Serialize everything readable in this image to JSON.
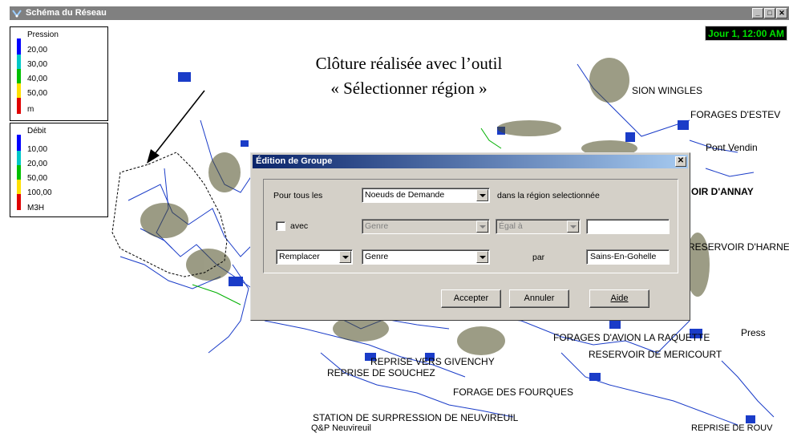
{
  "window": {
    "title": "Schéma du Réseau",
    "controls": [
      "_",
      "□",
      "✕"
    ],
    "day_time": "Jour 1, 12:00 AM"
  },
  "colors": {
    "legend_blue": "#0000ff",
    "legend_cyan": "#00c8c8",
    "legend_green": "#00c000",
    "legend_yellow": "#ffe000",
    "legend_red": "#e00000",
    "title_gradient_start": "#0a246a",
    "title_gradient_end": "#a6caf0"
  },
  "legend_pressure": {
    "title": "Pression",
    "items": [
      "20,00",
      "30,00",
      "40,00",
      "50,00"
    ],
    "unit": "m"
  },
  "legend_flow": {
    "title": "Débit",
    "items": [
      "10,00",
      "20,00",
      "50,00",
      "100,00"
    ],
    "unit": "M3H"
  },
  "annotation": {
    "line1": "Clôture réalisée avec l’outil",
    "line2": "« Sélectionner région »"
  },
  "map_labels": [
    "Q&P Neuvireuil",
    "STATION DE SURPRESSION DE NEUVIREUIL",
    "FORAGE DES FOURQUES",
    "REPRISE DE SOUCHEZ",
    "REPRISE VERS GIVENCHY",
    "RESERVOIR DE MERICOURT",
    "FORAGES D'AVION LA RAQUETTE",
    "RESERVOIR D'HARNES",
    "SION WINGLES",
    "FORAGES D'ESTEV",
    "Pont Vendin",
    "OIR D'ANNAY",
    "Press",
    "REPRISE DE ROUV"
  ],
  "dialog": {
    "title": "Édition de Groupe",
    "close": "✕",
    "row1": {
      "label": "Pour tous les",
      "object_select": "Noeuds de Demande",
      "suffix": "dans la  région selectionnée"
    },
    "row2": {
      "checkbox_label": "avec",
      "field_select": "Genre",
      "operator_select": "Égal à",
      "value": ""
    },
    "row3": {
      "action_select": "Remplacer",
      "field_select": "Genre",
      "by_label": "par",
      "new_value": "Sains-En-Gohelle"
    },
    "buttons": {
      "accept": "Accepter",
      "cancel": "Annuler",
      "help": "Aide"
    }
  }
}
